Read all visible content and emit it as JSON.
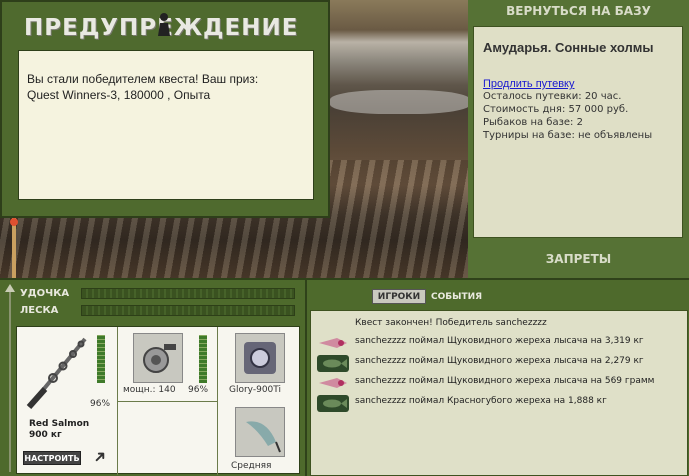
{
  "dialog": {
    "title": "ПРЕДУПРЕЖДЕНИЕ",
    "message_line1": "Вы стали победителем квеста! Ваш приз:",
    "message_line2": "Quest Winners-3, 180000 , Опыта"
  },
  "right_panel": {
    "return_button": "ВЕРНУТЬСЯ НА БАЗУ",
    "base_name": "Амударья. Сонные холмы",
    "extend_link": "Продлить путевку",
    "info": [
      "Осталось путевки: 20 час.",
      "Стоимость дня: 57 000 руб.",
      "Рыбаков на базе: 2",
      "Турниры на базе: не объявлены"
    ],
    "bans_button": "ЗАПРЕТЫ"
  },
  "tackle_panel": {
    "rod_label": "УДОЧКА",
    "line_label": "ЛЕСКА",
    "rod_percent": "96%",
    "rod_name": "Red Salmon",
    "rod_capacity": "900 кг",
    "setup_button": "НАСТРОИТЬ",
    "reel_power": "мощн.: 140",
    "reel_percent": "96%",
    "line_item": "Glory-900Ti",
    "bait_item": "Средняя",
    "rod_level": 0.96,
    "reel_level": 0.96
  },
  "events_panel": {
    "tab_players": "ИГРОКИ",
    "tab_events": "СОБЫТИЯ",
    "entries": [
      {
        "icon": "lure-icon",
        "text": "Квест закончен! Победитель sanchezzzz"
      },
      {
        "icon": "fish-icon",
        "text": "sanchezzzz поймал Щуковидного жереха лысача на 3,319 кг"
      },
      {
        "icon": "fish-icon",
        "text": "sanchezzzz поймал Щуковидного жереха лысача на 2,279 кг"
      },
      {
        "icon": "lure-icon",
        "text": "sanchezzzz поймал Щуковидного жереха лысача на 569 грамм"
      },
      {
        "icon": "fish-icon",
        "text": "sanchezzzz поймал Красногубого жереха на 1,888 кг"
      }
    ]
  },
  "colors": {
    "panel_green": "#4e6a2c",
    "cream": "#f5f3df",
    "link_blue": "#1a1ad0"
  }
}
